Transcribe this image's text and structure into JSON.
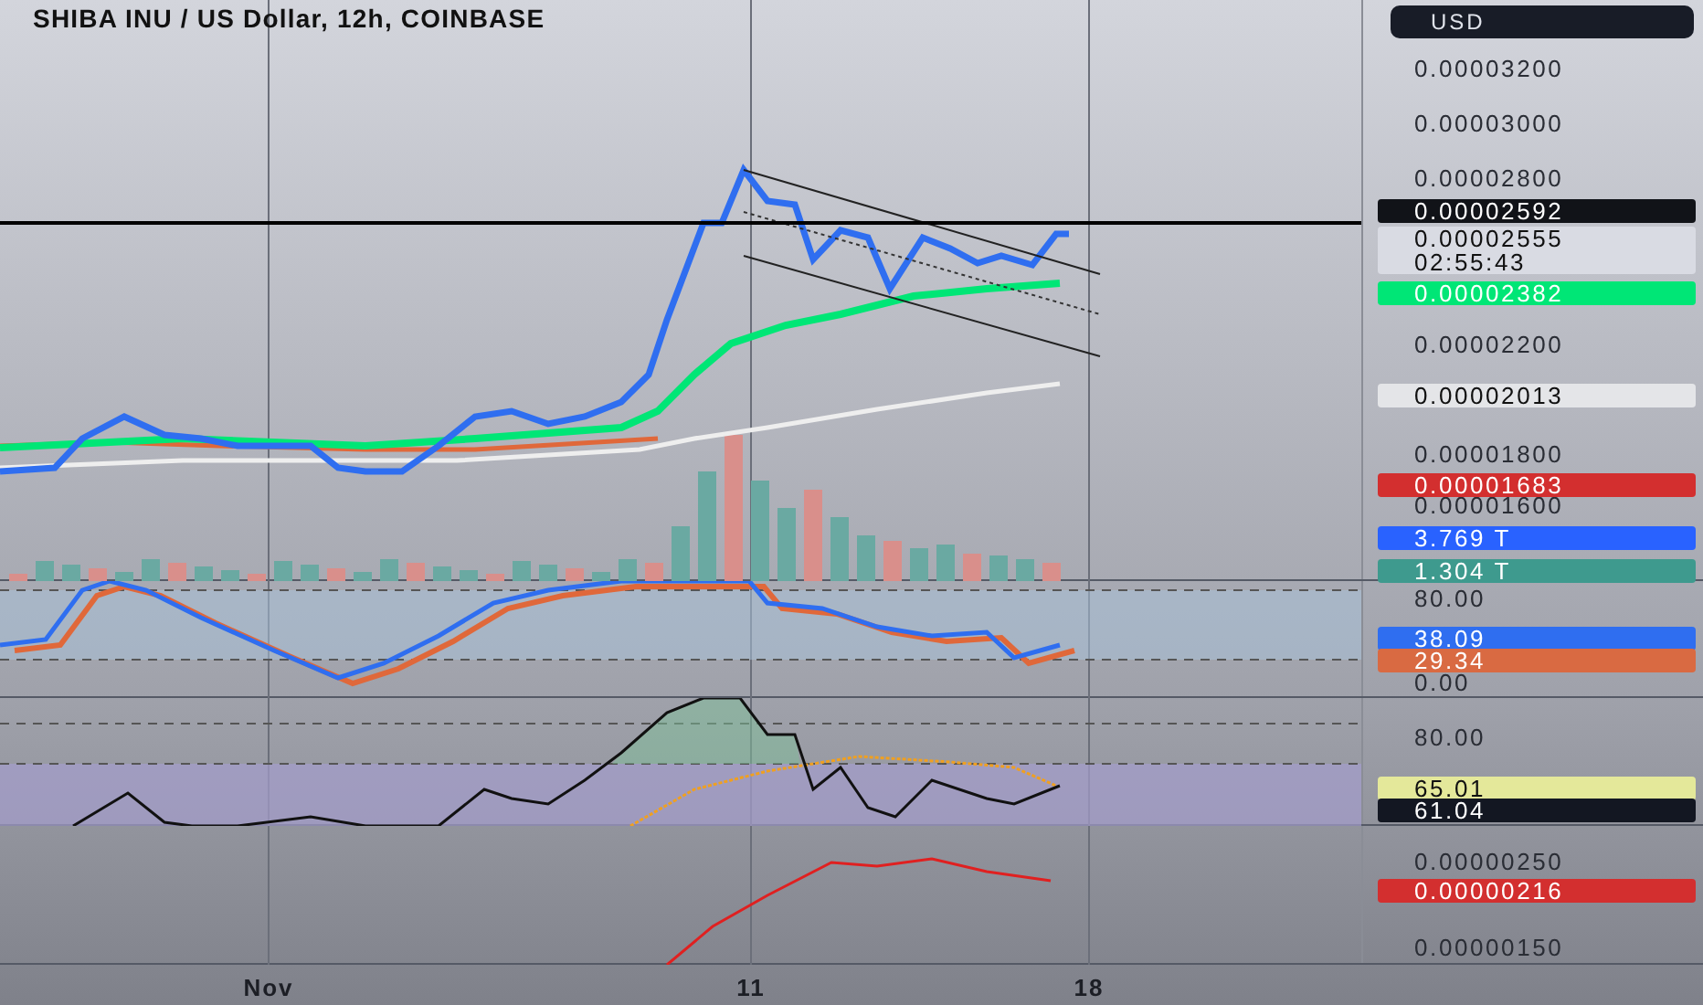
{
  "title": "SHIBA INU / US Dollar, 12h, COINBASE",
  "currency_button": "USD",
  "panes": [
    {
      "axis_labels": [
        "0.00003200",
        "0.00003000",
        "0.00002800",
        "0.00002200",
        "0.00001800",
        "0.00001600"
      ],
      "badges": [
        {
          "lines": [
            "0.00002592"
          ],
          "color": "#111318"
        },
        {
          "lines": [
            "0.00002555",
            "02:55:43"
          ],
          "color": "#d9dbe3"
        },
        {
          "lines": [
            "0.00002382"
          ],
          "color": "#00e676"
        },
        {
          "lines": [
            "0.00002013"
          ],
          "color": "#e4e5e8"
        },
        {
          "lines": [
            "0.00001683"
          ],
          "color": "#d32f2f"
        },
        {
          "lines": [
            "3.769 T"
          ],
          "color": "#2962ff"
        },
        {
          "lines": [
            "1.304 T"
          ],
          "color": "#3e9a8e"
        }
      ]
    },
    {
      "axis_labels": [
        "80.00",
        "0.00"
      ],
      "badges": [
        {
          "lines": [
            "38.09"
          ],
          "color": "#2f6ef0"
        },
        {
          "lines": [
            "29.34"
          ],
          "color": "#d96a42"
        }
      ]
    },
    {
      "axis_labels": [
        "80.00"
      ],
      "badges": [
        {
          "lines": [
            "65.01"
          ],
          "color": "#e4e89a"
        },
        {
          "lines": [
            "61.04"
          ],
          "color": "#131722"
        }
      ]
    },
    {
      "axis_labels": [
        "0.00000250",
        "0.00000150"
      ],
      "badges": [
        {
          "lines": [
            "0.00000216"
          ],
          "color": "#d32f2f"
        }
      ]
    }
  ],
  "time_axis": [
    "Nov",
    "11",
    "18"
  ]
}
